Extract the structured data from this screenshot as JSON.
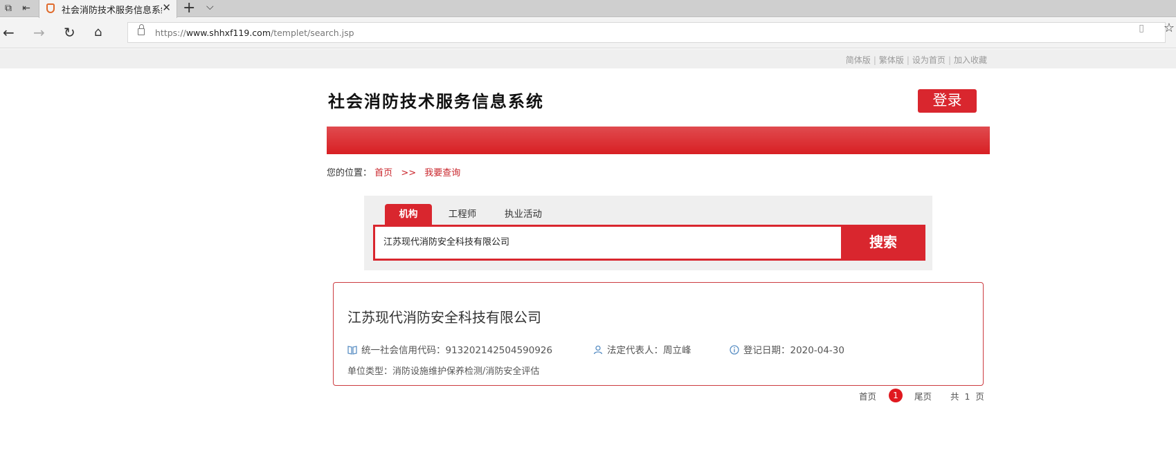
{
  "browser": {
    "tab_title": "社会消防技术服务信息系统",
    "url_prefix": "https://",
    "url_domain": "www.shhxf119.com",
    "url_path": "/templet/search.jsp"
  },
  "util_links": [
    "简体版",
    "繁体版",
    "设为首页",
    "加入收藏"
  ],
  "header": {
    "site_title": "社会消防技术服务信息系统",
    "login_label": "登录"
  },
  "breadcrumb": {
    "prefix": "您的位置：",
    "home": "首页",
    "separator": ">>",
    "current": "我要查询"
  },
  "search": {
    "tabs": [
      "机构",
      "工程师",
      "执业活动"
    ],
    "active_tab": "机构",
    "query": "江苏现代消防安全科技有限公司",
    "button_label": "搜索"
  },
  "result": {
    "company_name": "江苏现代消防安全科技有限公司",
    "credit_code_label": "统一社会信用代码：",
    "credit_code": "913202142504590926",
    "legal_rep_label": "法定代表人：",
    "legal_rep": "周立峰",
    "reg_date_label": "登记日期：",
    "reg_date": "2020-04-30",
    "type_label": "单位类型：",
    "type_value": "消防设施维护保养检测/消防安全评估"
  },
  "pagination": {
    "first": "首页",
    "current_page": "1",
    "last": "尾页",
    "total_prefix": "共",
    "total_pages": "1",
    "total_suffix": "页"
  },
  "colors": {
    "brand_red": "#d9262e",
    "page_indicator_red": "#e0191f"
  }
}
